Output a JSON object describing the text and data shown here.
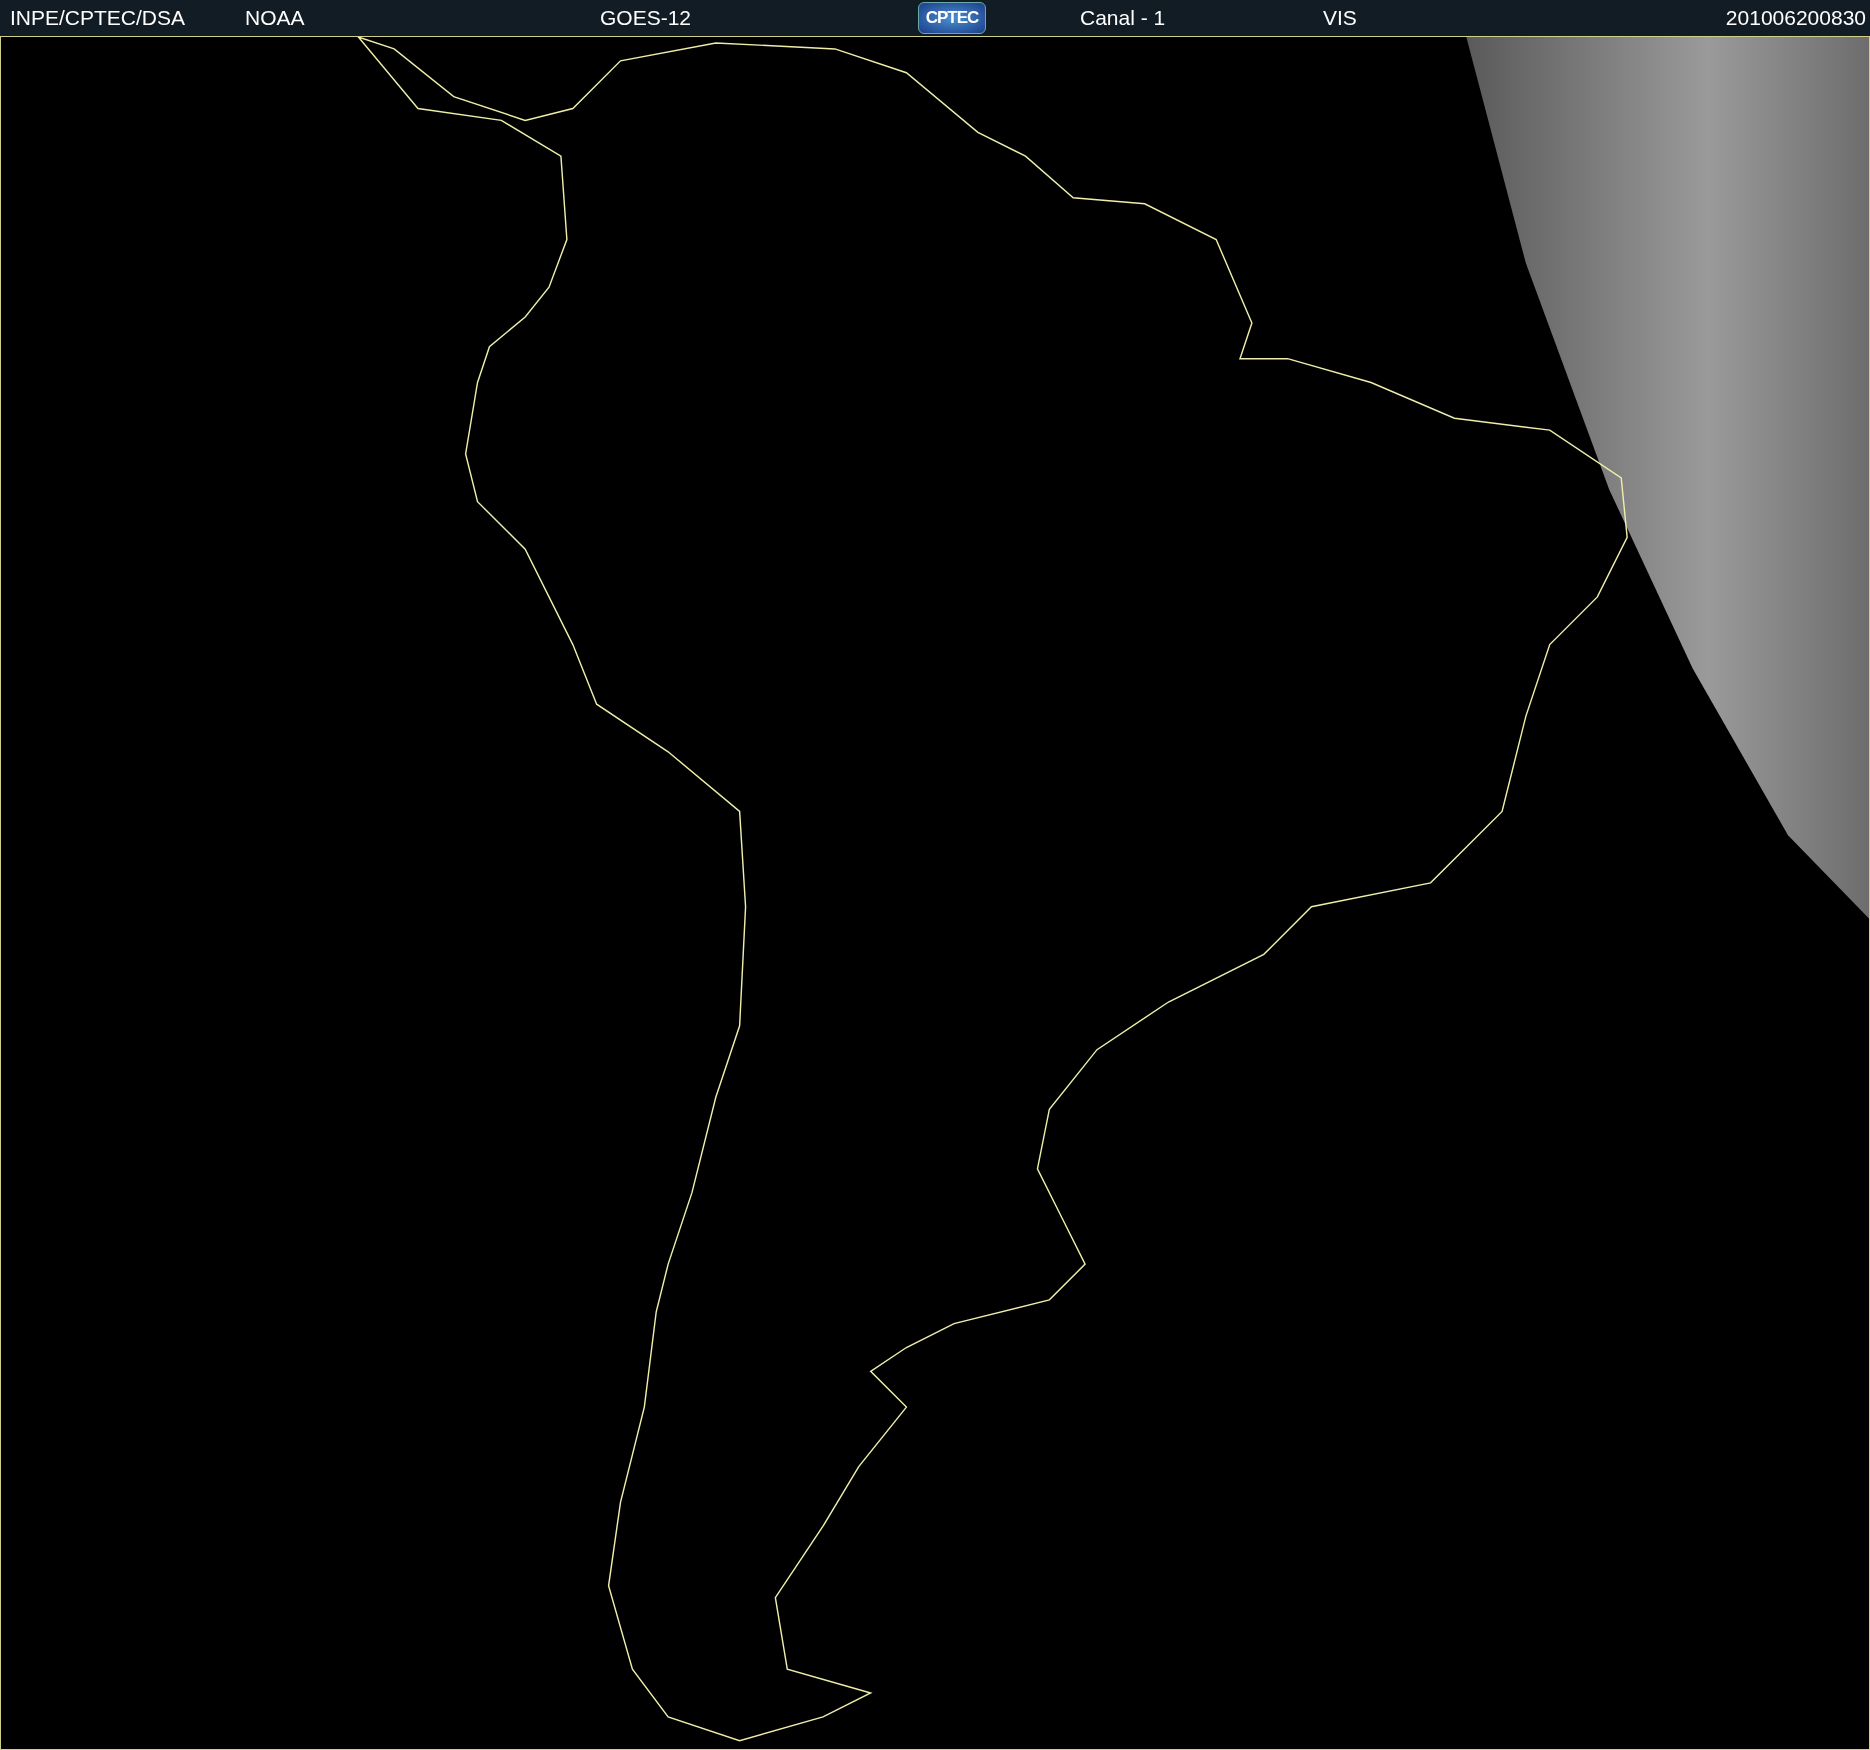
{
  "header": {
    "source": "INPE/CPTEC/DSA",
    "agency": "NOAA",
    "satellite": "GOES-12",
    "logo_text": "CPTEC",
    "channel": "Canal - 1",
    "band": "VIS",
    "timestamp": "201006200830"
  }
}
